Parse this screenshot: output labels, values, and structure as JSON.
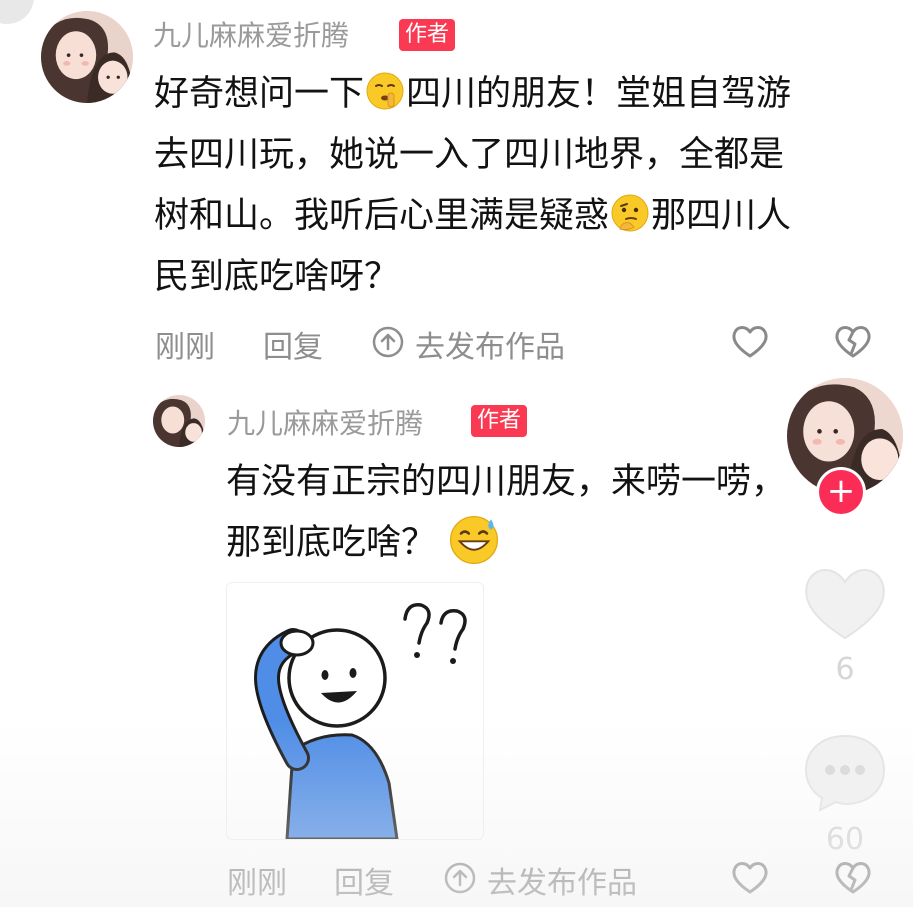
{
  "comment": {
    "username": "九儿麻麻爱折腾",
    "author_badge": "作者",
    "lines": [
      "好奇想问一下",
      "四川的朋友！堂姐自驾游",
      "去四川玩，她说一入了四川地界，全都是",
      "树和山。我听后心里满是疑惑",
      "那四川人",
      "民到底吃啥呀？"
    ],
    "emojis": [
      "shushing-face-emoji",
      "thinking-face-emoji"
    ],
    "time": "刚刚",
    "reply_label": "回复",
    "post_label": "去发布作品"
  },
  "reply": {
    "username": "九儿麻麻爱折腾",
    "author_badge": "作者",
    "lines": [
      "有没有正宗的四川朋友，来唠一唠，",
      "那到底吃啥？"
    ],
    "emojis": [
      "grinning-sweat-emoji"
    ],
    "sticker": "confused-stickman-sticker",
    "time": "刚刚",
    "reply_label": "回复",
    "post_label": "去发布作品"
  },
  "side_panel": {
    "like_count": "6",
    "comment_count": "60",
    "follow_symbol": "+"
  },
  "colors": {
    "badge": "#fa3a52",
    "follow": "#fb2c55",
    "meta_gray": "#8e8e8e",
    "text": "#121212"
  }
}
